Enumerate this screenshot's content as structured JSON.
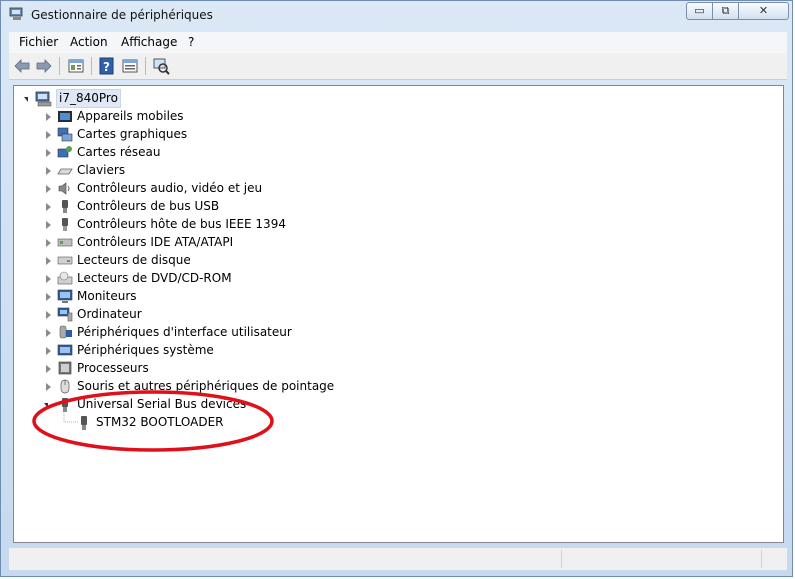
{
  "window": {
    "title": "Gestionnaire de périphériques"
  },
  "title_controls": {
    "minimize": "▭",
    "maximize": "⧉",
    "close": "✕"
  },
  "menu": [
    "Fichier",
    "Action",
    "Affichage",
    "?"
  ],
  "toolbar": {
    "buttons": [
      "back-arrow-icon",
      "forward-arrow-icon",
      "properties-icon",
      "help-icon",
      "details-icon",
      "scan-hardware-icon"
    ]
  },
  "tree": {
    "root": "i7_840Pro",
    "categories": [
      {
        "label": "Appareils mobiles",
        "icon": "mobile-device-icon"
      },
      {
        "label": "Cartes graphiques",
        "icon": "display-adapter-icon"
      },
      {
        "label": "Cartes réseau",
        "icon": "network-adapter-icon"
      },
      {
        "label": "Claviers",
        "icon": "keyboard-icon"
      },
      {
        "label": "Contrôleurs audio, vidéo et jeu",
        "icon": "audio-speaker-icon"
      },
      {
        "label": "Contrôleurs de bus USB",
        "icon": "usb-controller-icon"
      },
      {
        "label": "Contrôleurs hôte de bus IEEE 1394",
        "icon": "ieee1394-icon"
      },
      {
        "label": "Contrôleurs IDE ATA/ATAPI",
        "icon": "ide-controller-icon"
      },
      {
        "label": "Lecteurs de disque",
        "icon": "disk-drive-icon"
      },
      {
        "label": "Lecteurs de DVD/CD-ROM",
        "icon": "dvd-drive-icon"
      },
      {
        "label": "Moniteurs",
        "icon": "monitor-icon"
      },
      {
        "label": "Ordinateur",
        "icon": "computer-icon"
      },
      {
        "label": "Périphériques d'interface utilisateur",
        "icon": "hid-icon"
      },
      {
        "label": "Périphériques système",
        "icon": "system-device-icon"
      },
      {
        "label": "Processeurs",
        "icon": "processor-icon"
      },
      {
        "label": "Souris et autres périphériques de pointage",
        "icon": "mouse-icon"
      }
    ],
    "expanded": {
      "label": "Universal Serial Bus devices",
      "icon": "usb-device-icon",
      "children": [
        {
          "label": "STM32  BOOTLOADER",
          "icon": "usb-plug-icon"
        }
      ]
    }
  },
  "annotation": {
    "color": "#e0101a"
  },
  "colors": {
    "accent": "#3a6fb0",
    "selection": "#dfe8f4"
  }
}
